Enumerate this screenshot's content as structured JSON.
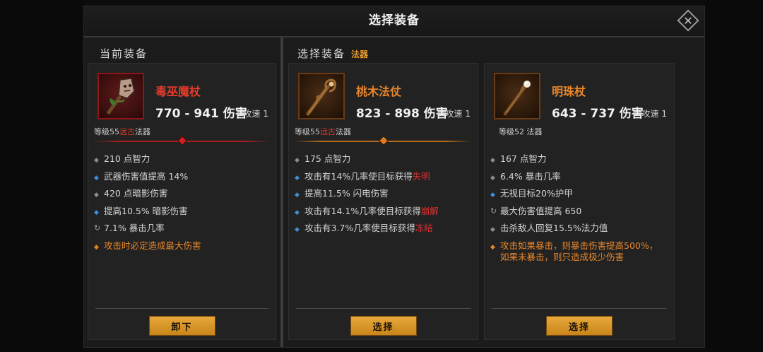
{
  "title": "选择装备",
  "close_icon": "close-icon",
  "current_section": {
    "label": "当前装备"
  },
  "select_section": {
    "label": "选择装备",
    "tag": "法器"
  },
  "colors": {
    "legendary_orange": "#e8862b",
    "ancient_red": "#e22e2e",
    "magic_blue": "#3f8fd8",
    "button_gold": "#d99424"
  },
  "items": [
    {
      "name": "毒巫魔杖",
      "name_color": "#e23b2b",
      "damage": "770 - 941 伤害",
      "speed": "攻速 1",
      "level_prefix": "等级55",
      "level_ancient": "远古",
      "level_type": "法器",
      "icon": "voodoo-staff-icon",
      "stats": [
        {
          "bullet": "grey",
          "text": "210 点智力"
        },
        {
          "bullet": "blue",
          "text": "武器伤害值提高 14%"
        },
        {
          "bullet": "grey",
          "text": "420 点暗影伤害"
        },
        {
          "bullet": "blue",
          "text": "提高10.5% 暗影伤害"
        },
        {
          "bullet": "cycle",
          "text": "7.1% 暴击几率"
        },
        {
          "bullet": "orange",
          "text": "攻击时必定造成最大伤害",
          "orange": true
        }
      ],
      "button": "卸下"
    },
    {
      "name": "桃木法仗",
      "name_color": "#e8862b",
      "damage": "823 - 898 伤害",
      "speed": "攻速 1",
      "level_prefix": "等级55",
      "level_ancient": "远古",
      "level_type": "法器",
      "icon": "peachwood-staff-icon",
      "stats": [
        {
          "bullet": "grey",
          "text": "175 点智力"
        },
        {
          "bullet": "blue",
          "text": "攻击有14%几率使目标获得",
          "red": "失明"
        },
        {
          "bullet": "blue",
          "text": "提高11.5% 闪电伤害"
        },
        {
          "bullet": "blue",
          "text": "攻击有14.1%几率使目标获得",
          "red": "崩解"
        },
        {
          "bullet": "blue",
          "text": "攻击有3.7%几率使目标获得",
          "red": "冻结"
        }
      ],
      "button": "选择"
    },
    {
      "name": "明珠杖",
      "name_color": "#e8862b",
      "damage": "643 - 737 伤害",
      "speed": "攻速 1",
      "level_prefix": "等级52",
      "level_ancient": "",
      "level_type": "法器",
      "icon": "pearl-staff-icon",
      "stats": [
        {
          "bullet": "grey",
          "text": "167 点智力"
        },
        {
          "bullet": "grey",
          "text": "6.4% 暴击几率"
        },
        {
          "bullet": "blue",
          "text": "无视目标20%护甲"
        },
        {
          "bullet": "cycle",
          "text": "最大伤害值提高 650"
        },
        {
          "bullet": "grey",
          "text": "击杀敌人回复15.5%法力值"
        },
        {
          "bullet": "orange",
          "text": "攻击如果暴击，则暴击伤害提高500%，",
          "text2": "如果未暴击，则只造成极少伤害",
          "orange": true
        }
      ],
      "button": "选择"
    }
  ]
}
